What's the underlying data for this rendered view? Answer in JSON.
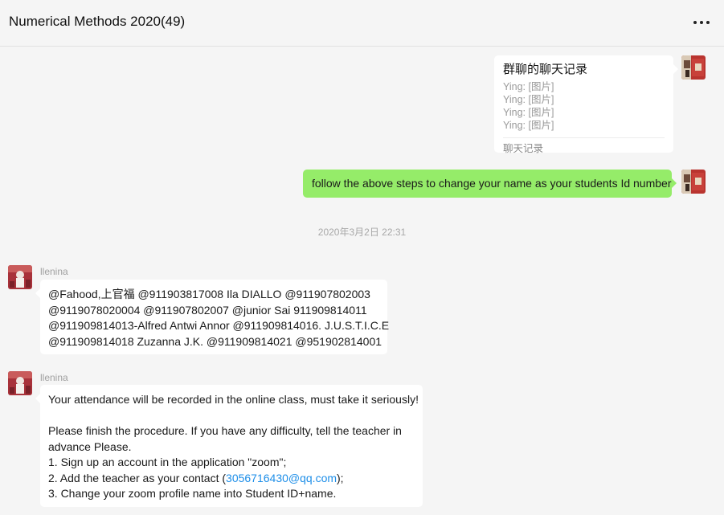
{
  "header": {
    "title": "Numerical Methods 2020(49)"
  },
  "messages": {
    "record": {
      "title": "群聊的聊天记录",
      "lines": [
        "Ying: [图片]",
        "Ying: [图片]",
        "Ying: [图片]",
        "Ying: [图片]"
      ],
      "footer": "聊天记录"
    },
    "self_text": "follow the above steps to change your name as your students Id number",
    "timestamp": "2020年3月2日 22:31",
    "msg1": {
      "sender": "llenina",
      "lines": [
        "@Fahood,上官福 @911903817008 Ila DIALLO @911907802003",
        "@9119078020004 @911907802007 @junior Sai 911909814011",
        "@911909814013-Alfred Antwi Annor @911909814016.  J.U.S.T.I.C.E",
        "@911909814018 Zuzanna J.K. @911909814021 @951902814001"
      ]
    },
    "msg2": {
      "sender": "llenina",
      "line1": "Your attendance will be recorded in the online class, must take it seriously!",
      "line2": "Please finish the procedure. If you have any difficulty, tell the teacher in",
      "line3": "advance Please.",
      "line4": "1. Sign up an account in the application \"zoom\";",
      "line5_prefix": "2. Add the teacher as your contact (",
      "line5_link": "3056716430@qq.com",
      "line5_suffix": ");",
      "line6": "3. Change your zoom profile name into Student ID+name."
    }
  },
  "colors": {
    "self_bubble": "#95ec69",
    "other_bubble": "#ffffff",
    "link": "#1d8ee8",
    "background": "#f5f5f5"
  },
  "icons": {
    "more": "more-icon",
    "self_avatar": "self-avatar",
    "sender_avatar": "sender-avatar"
  }
}
